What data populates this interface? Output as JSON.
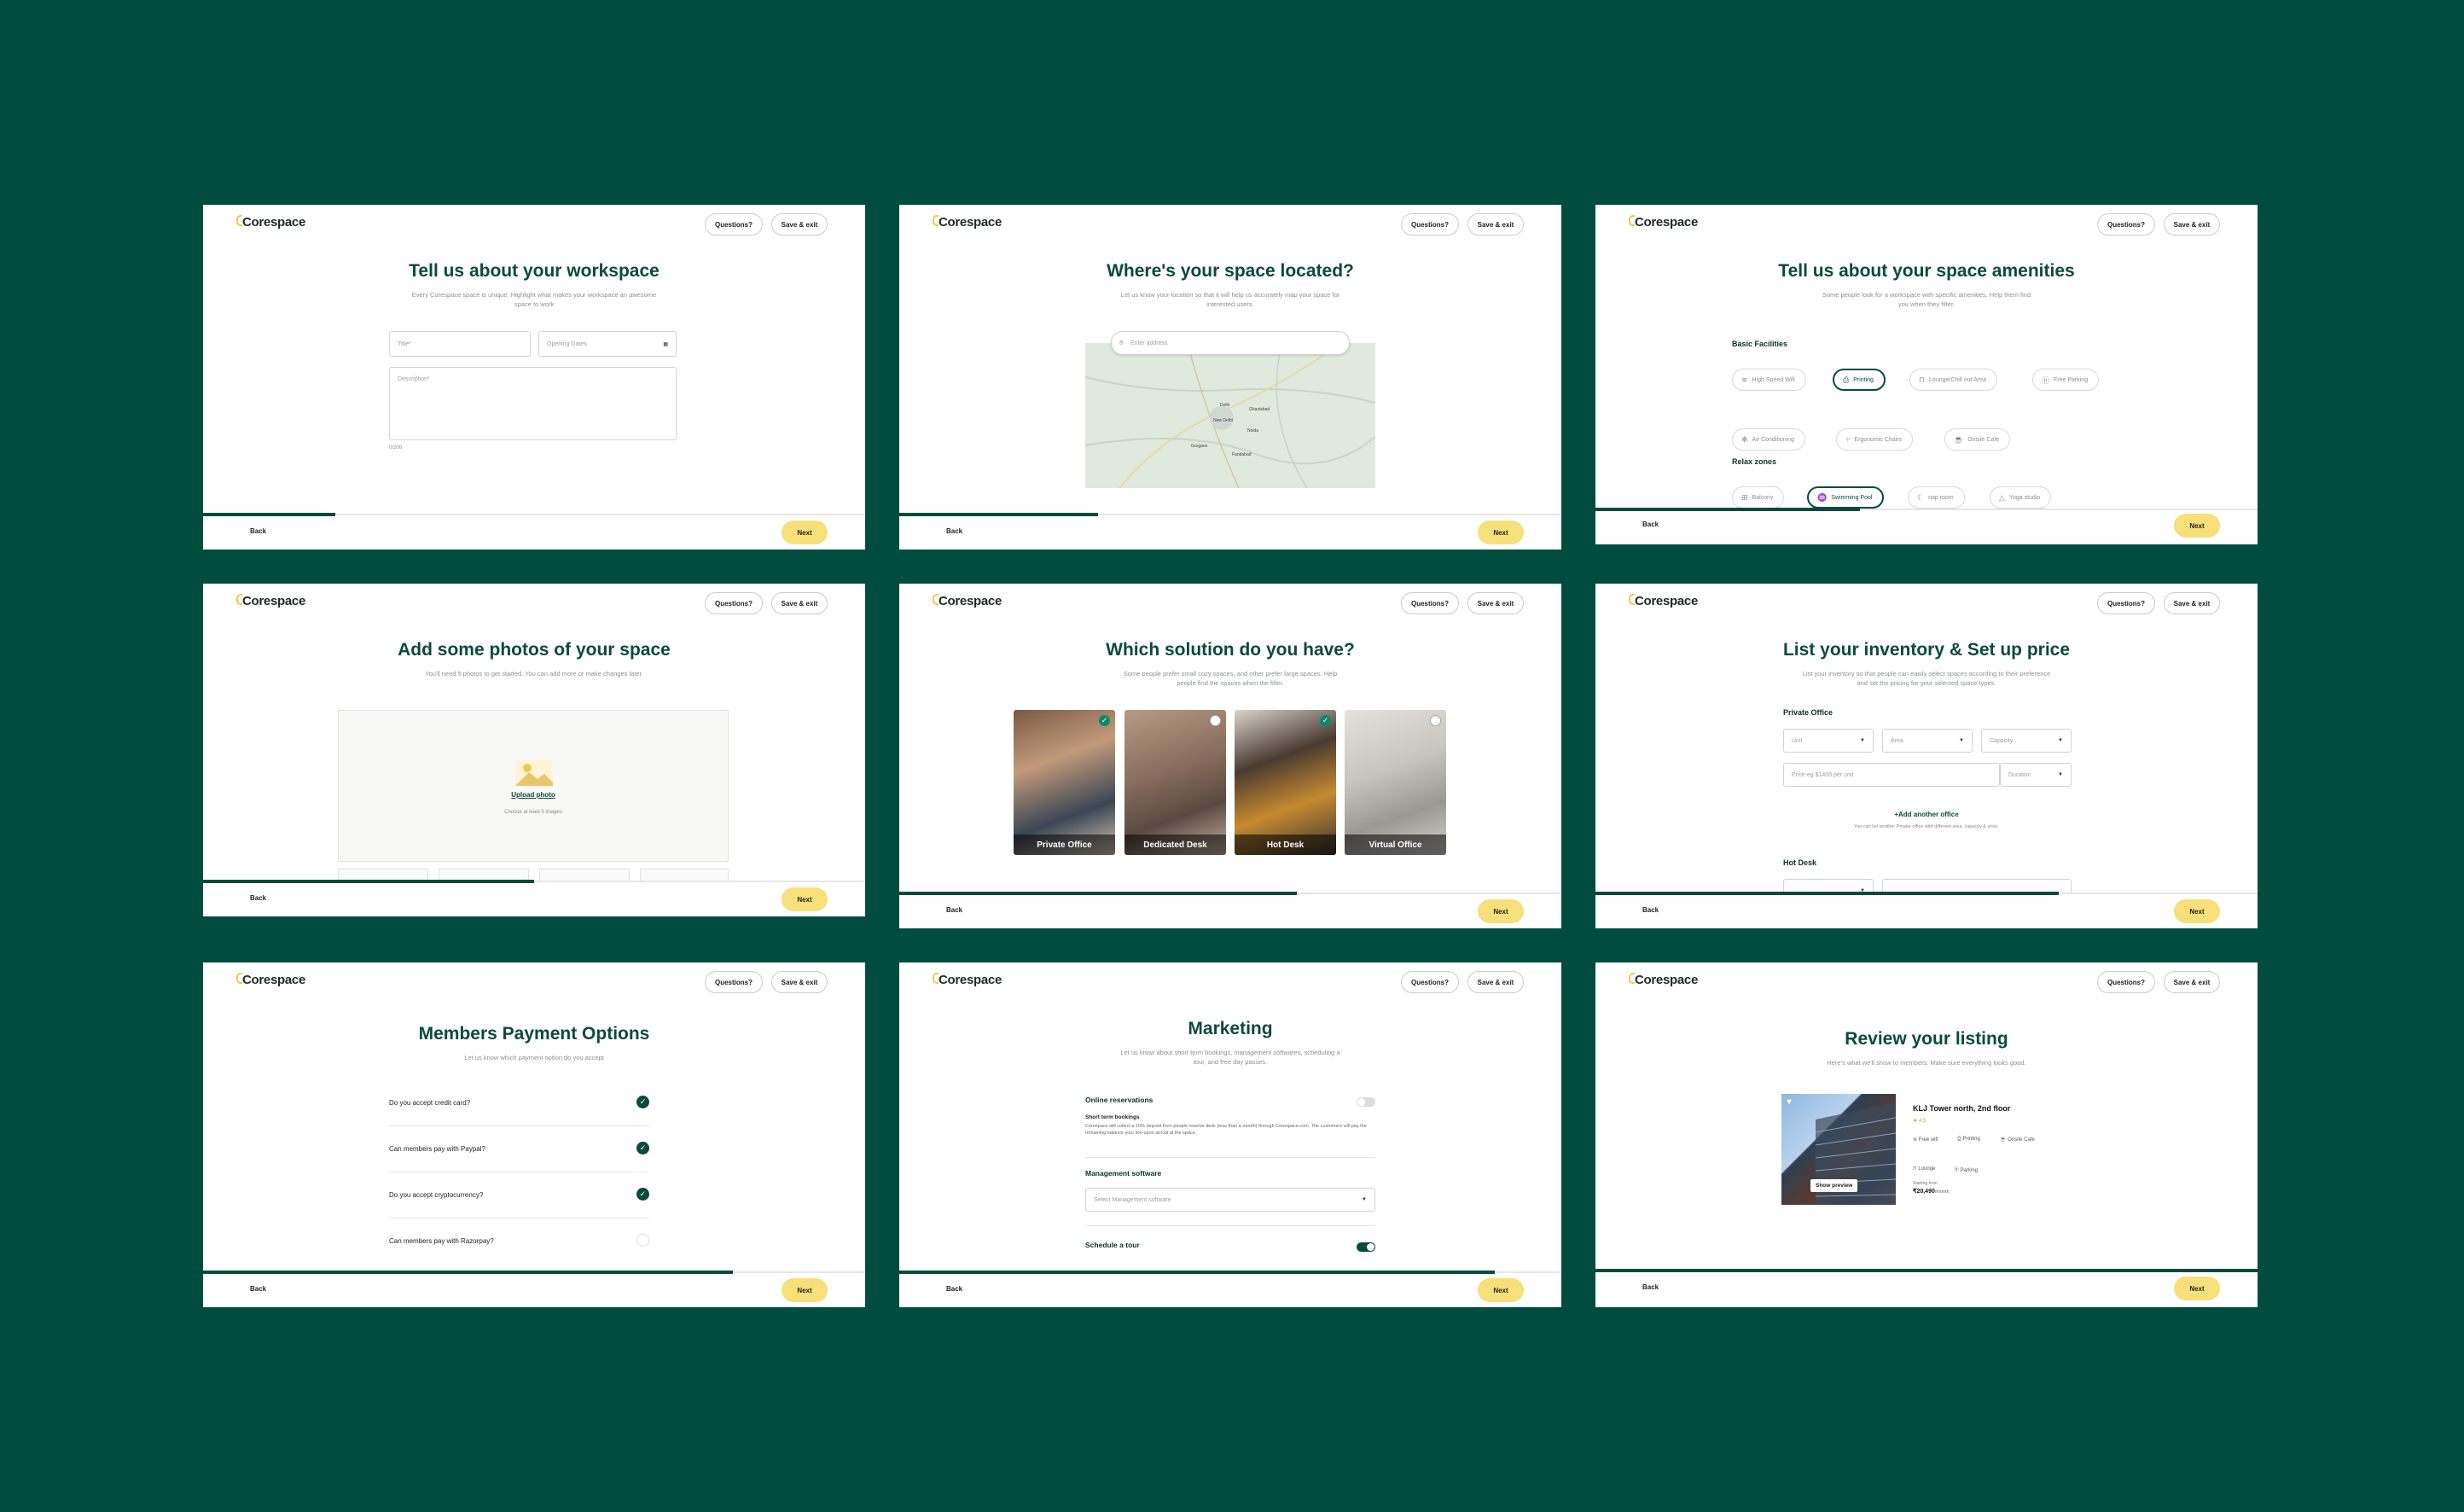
{
  "brand": "Corespace",
  "header": {
    "questions_label": "Questions?",
    "save_exit_label": "Save & exit"
  },
  "footer": {
    "back_label": "Back",
    "next_label": "Next"
  },
  "colors": {
    "background": "#004d40",
    "primary": "#0b4a3c",
    "accent": "#f7e07a"
  },
  "s1": {
    "title": "Tell us about your workspace",
    "subtitle": "Every Corespace space is unique. Highlight what makes your workspace an awesome space to work",
    "title_field": "Title*",
    "opening_dates_field": "Opening Dates",
    "description_field": "Description*",
    "counter": "0/200",
    "progress": 0.2
  },
  "s2": {
    "title": "Where's your space located?",
    "subtitle": "Let us know your location so that it will help us accurately map your space for interested users.",
    "address_placeholder": "Enter address",
    "map_labels": [
      "Delhi",
      "Ghaziabad",
      "New Delhi",
      "Noida",
      "Faridabad",
      "Gurgaon"
    ],
    "progress": 0.3
  },
  "s3": {
    "title": "Tell us about your space amenities",
    "subtitle": "Some people look for a workspace with specific amenities. Help them find you when they filter.",
    "basic_facilities_label": "Basic Facilities",
    "basic": [
      "High Speed Wifi",
      "Printing",
      "Lounge/Chill out Area",
      "Free Parking",
      "Air Conditioning",
      "Ergonomic Chairs",
      "Onsite Cafe"
    ],
    "relax_zones_label": "Relax zones",
    "relax": [
      "Balcony",
      "Swimming Pool",
      "nap room",
      "Yoga studio"
    ],
    "progress": 0.4
  },
  "s4": {
    "title": "Add some photos of your space",
    "subtitle": "You'll need 5 photos to get started. You can add more or make changes later.",
    "upload_label": "Upload photo",
    "upload_hint": "Choose at least 5 images",
    "progress": 0.5
  },
  "s5": {
    "title": "Which solution do you have?",
    "subtitle": "Some people prefer small cozy spaces, and other prefer large spaces. Help people find the spaces when the filter.",
    "solutions": [
      {
        "label": "Private Office",
        "selected": true
      },
      {
        "label": "Dedicated Desk",
        "selected": false
      },
      {
        "label": "Hot Desk",
        "selected": true
      },
      {
        "label": "Virtual Office",
        "selected": false
      }
    ],
    "progress": 0.6
  },
  "s6": {
    "title": "List your inventory & Set up price",
    "subtitle": "List your inventory so that people can easily select spaces according to their preference and set the pricing for your selected space types.",
    "private_office_label": "Private Office",
    "unit": "Unit",
    "area": "Area",
    "capacity": "Capacity",
    "price_placeholder": "Price eg $1400 per unit",
    "duration": "Duration",
    "add_office": "+Add another office",
    "add_office_hint": "You can list another Private office with different area, capacity & price.",
    "hot_desk_label": "Hot Desk",
    "progress": 0.7
  },
  "s7": {
    "title": "Members Payment Options",
    "subtitle": "Let us know which payment option do you accept",
    "questions": [
      {
        "text": "Do you accept credit card?",
        "checked": true
      },
      {
        "text": "Can members pay with Paypal?",
        "checked": true
      },
      {
        "text": "Do you accept cryptocurrency?",
        "checked": true
      },
      {
        "text": "Can members pay with Razorpay?",
        "checked": false
      }
    ],
    "progress": 0.8
  },
  "s8": {
    "title": "Marketing",
    "subtitle": "Let us know about short term bookings, management softwares, scheduling a tour, and free day passes.",
    "online_reservations": "Online reservations",
    "short_term_label": "Short term bookings",
    "short_term_desc": "Corespace will collect a 10% deposit from people reserve desk (less than a month) through Corespace.com. The customers will pay the remaining balance your live upon arrival at the space.",
    "management_software": "Management software",
    "management_placeholder": "Select Management software",
    "schedule_tour": "Schedule a tour",
    "progress": 0.9
  },
  "s9": {
    "title": "Review your listing",
    "subtitle": "Here's what we'll show to members. Make sure everything looks good.",
    "listing_name": "KLJ Tower north, 2nd floor",
    "rating": "★ 4.5",
    "amenities_row1": [
      "Free wifi",
      "Printing",
      "Onsite Cafe"
    ],
    "amenities_row2": [
      "Lounge",
      "Parking"
    ],
    "starting_from": "Starting from",
    "price": "₹20,490",
    "price_unit": "/month",
    "show_preview": "Show preview",
    "progress": 1.0
  }
}
